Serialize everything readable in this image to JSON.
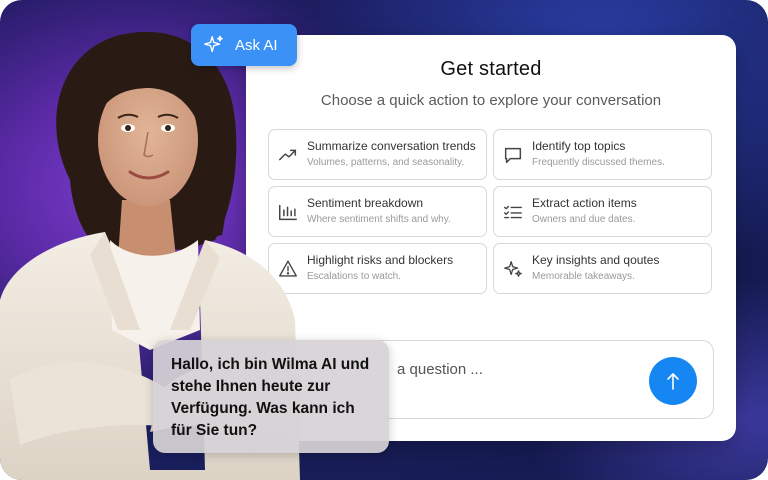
{
  "badge": {
    "label": "Ask AI",
    "icon": "sparkle-icon",
    "color": "#3b91f5"
  },
  "card": {
    "title": "Get started",
    "subtitle": "Choose a quick action to explore your conversation"
  },
  "actions": [
    {
      "title": "Summarize conversation trends",
      "desc": "Volumes, patterns, and seasonality.",
      "icon": "trend-up-icon"
    },
    {
      "title": "Identify top topics",
      "desc": "Frequently discussed themes.",
      "icon": "chat-bubble-icon"
    },
    {
      "title": "Sentiment breakdown",
      "desc": "Where sentiment shifts and why.",
      "icon": "bar-chart-icon"
    },
    {
      "title": "Extract action items",
      "desc": "Owners and due dates.",
      "icon": "checklist-icon"
    },
    {
      "title": "Highlight risks and blockers",
      "desc": "Escalations to watch.",
      "icon": "warning-icon"
    },
    {
      "title": "Key insights and qoutes",
      "desc": "Memorable takeaways.",
      "icon": "sparkle-icon"
    }
  ],
  "input": {
    "placeholder": "a question ...",
    "send_icon": "arrow-up-icon",
    "send_color": "#1687f2"
  },
  "bubble": {
    "text": "Hallo, ich bin Wilma AI und stehe Ihnen heute zur Verfügung. Was kann ich für Sie tun?"
  }
}
